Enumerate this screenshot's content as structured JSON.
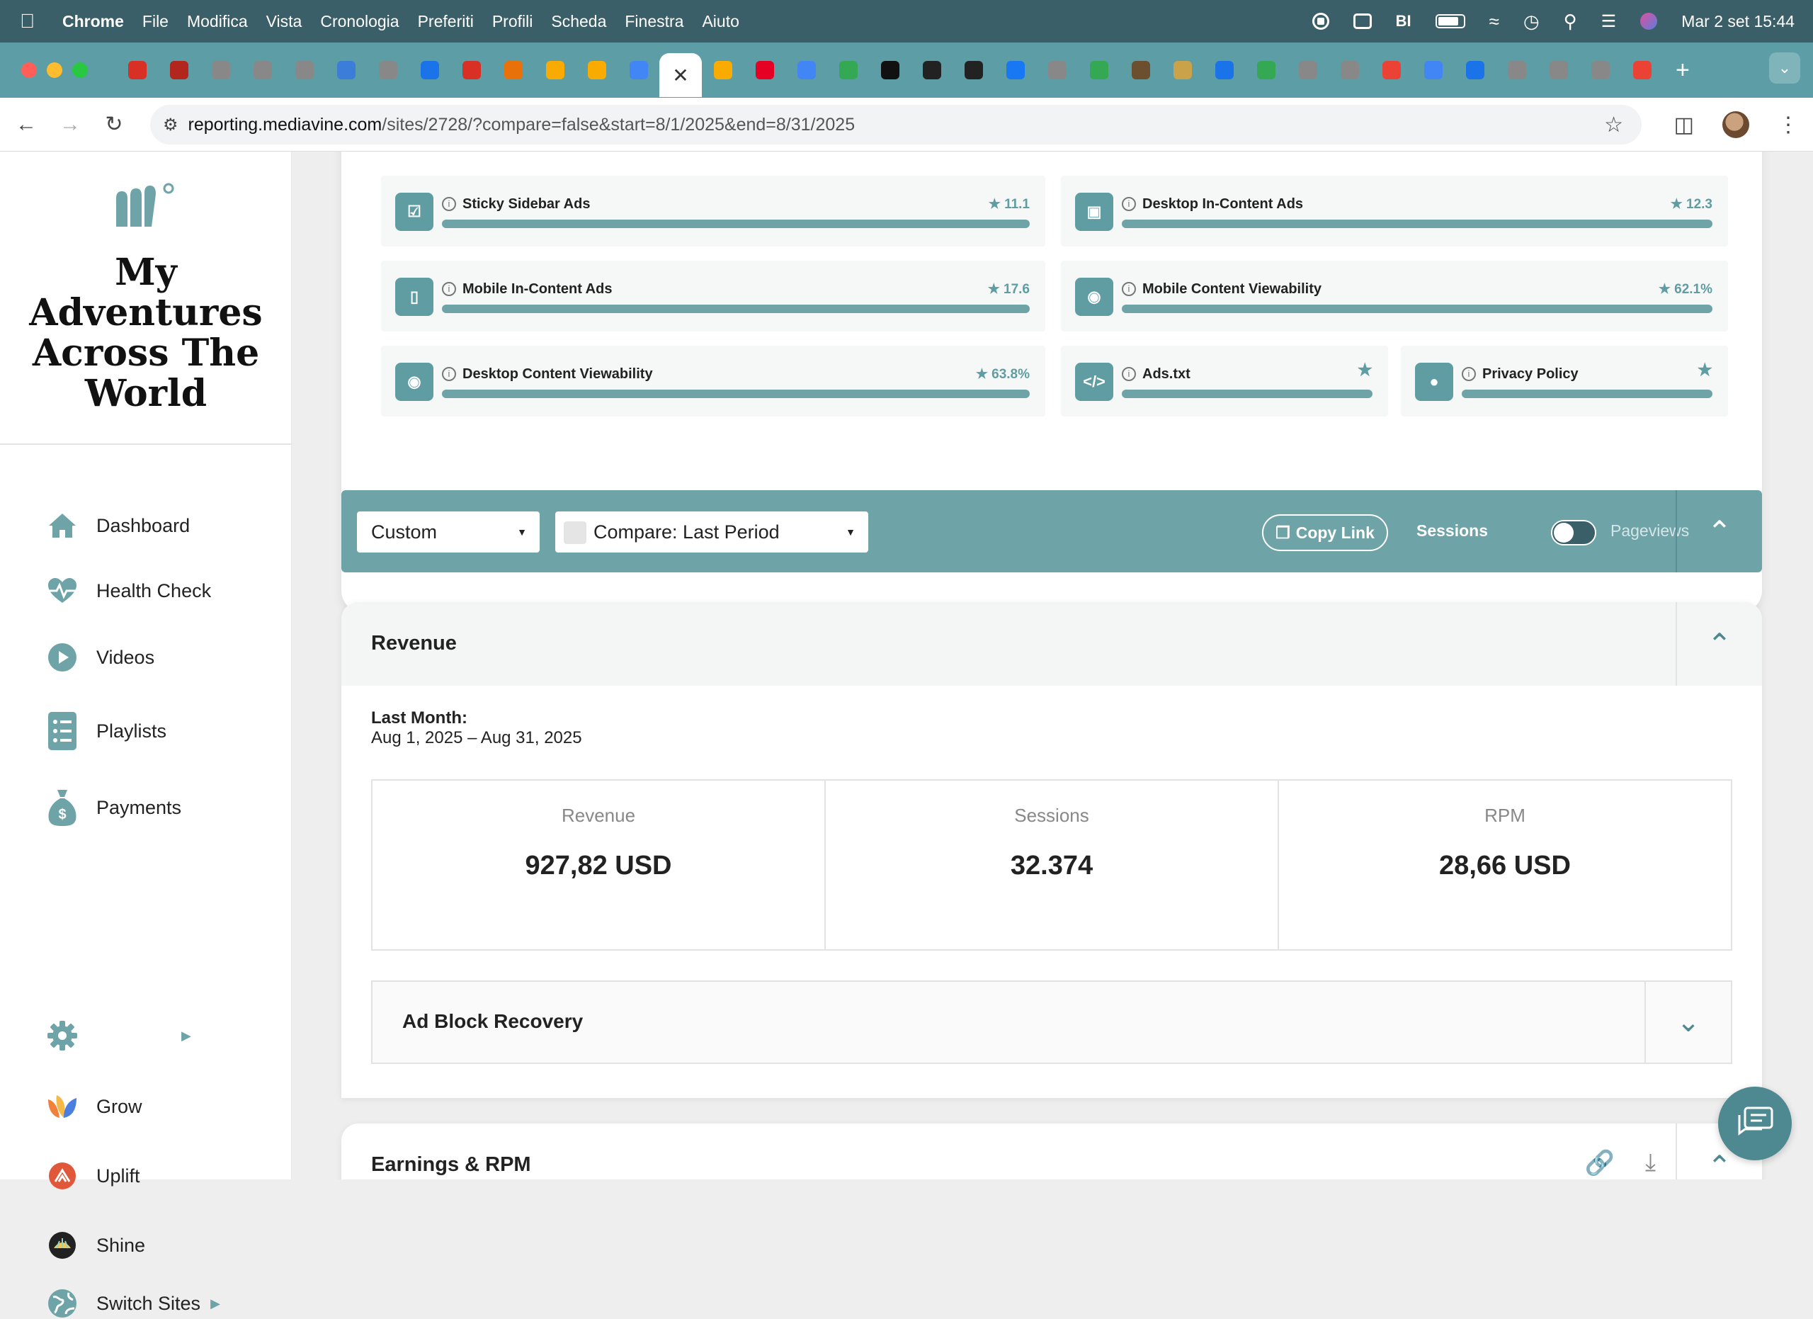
{
  "menubar": {
    "app": "Chrome",
    "items": [
      "File",
      "Modifica",
      "Vista",
      "Cronologia",
      "Preferiti",
      "Profili",
      "Scheda",
      "Finestra",
      "Aiuto"
    ],
    "datetime": "Mar 2 set  15:44"
  },
  "browser": {
    "url_host": "reporting.mediavine.com",
    "url_path": "/sites/2728/?compare=false&start=8/1/2025&end=8/31/2025",
    "tab_colors": [
      "#d93025",
      "#b3261e",
      "#888888",
      "#888888",
      "#888888",
      "#3b7dd8",
      "#888888",
      "#1a73e8",
      "#d93025",
      "#e8710a",
      "#f9ab00",
      "#f9ab00",
      "#4285f4",
      "#ffffff",
      "#f9ab00",
      "#e60023",
      "#4285f4",
      "#34a853",
      "#111111",
      "#222222",
      "#222222",
      "#1877f2",
      "#888888",
      "#34a853",
      "#6b4f2f",
      "#c9a24a",
      "#1a73e8",
      "#34a853",
      "#888888",
      "#888888",
      "#ea4335",
      "#4285f4",
      "#1a73e8",
      "#888888",
      "#888888",
      "#888888",
      "#ea4335"
    ]
  },
  "sidebar": {
    "site_name": "My Adventures Across The World",
    "items": [
      {
        "label": "Dashboard",
        "icon": "home-icon"
      },
      {
        "label": "Health Check",
        "icon": "heartbeat-icon"
      },
      {
        "label": "Videos",
        "icon": "play-circle-icon"
      },
      {
        "label": "Playlists",
        "icon": "list-icon"
      },
      {
        "label": "Payments",
        "icon": "money-bag-icon"
      },
      {
        "label": "",
        "icon": "gear-icon"
      },
      {
        "label": "Grow",
        "icon": "grow-icon"
      },
      {
        "label": "Uplift",
        "icon": "uplift-icon"
      },
      {
        "label": "Shine",
        "icon": "shine-icon"
      },
      {
        "label": "Switch Sites",
        "icon": "globe-icon"
      }
    ]
  },
  "health_check": {
    "items": [
      {
        "label": "Sticky Sidebar Ads",
        "score": "11.1",
        "icon": "sidebar-layout-icon"
      },
      {
        "label": "Desktop In-Content Ads",
        "score": "12.3",
        "icon": "desktop-icon"
      },
      {
        "label": "Mobile In-Content Ads",
        "score": "17.6",
        "icon": "mobile-icon"
      },
      {
        "label": "Mobile Content Viewability",
        "score": "62.1%",
        "icon": "mobile-eye-icon"
      },
      {
        "label": "Desktop Content Viewability",
        "score": "63.8%",
        "icon": "desktop-eye-icon"
      },
      {
        "label": "Ads.txt",
        "score": "",
        "icon": "code-icon"
      },
      {
        "label": "Privacy Policy",
        "score": "",
        "icon": "lock-icon"
      }
    ]
  },
  "filters": {
    "range": "Custom",
    "compare": "Compare: Last Period",
    "copy_link": "Copy Link",
    "toggle_left": "Sessions",
    "toggle_right": "Pageviews"
  },
  "revenue": {
    "title": "Revenue",
    "period_label": "Last Month:",
    "period_range": "Aug 1, 2025 – Aug 31, 2025",
    "stats": [
      {
        "label": "Revenue",
        "value": "927,82 USD"
      },
      {
        "label": "Sessions",
        "value": "32.374"
      },
      {
        "label": "RPM",
        "value": "28,66 USD"
      }
    ],
    "ad_block": "Ad Block Recovery"
  },
  "earnings": {
    "title": "Earnings & RPM"
  },
  "colors": {
    "teal": "#6ea3a8",
    "dark_teal": "#3b5f68"
  }
}
